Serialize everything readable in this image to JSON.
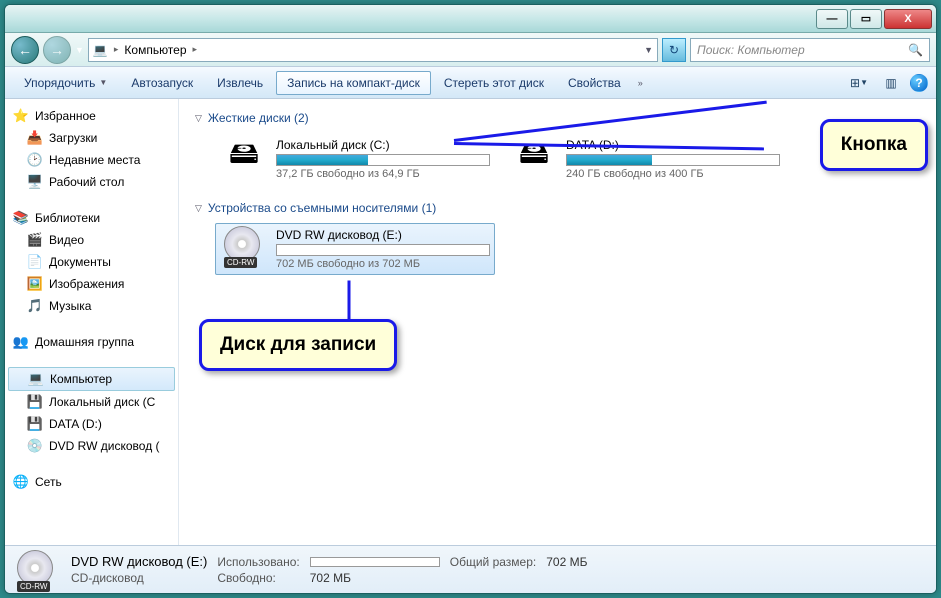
{
  "window": {
    "min": "—",
    "max": "▭",
    "close": "X"
  },
  "nav": {
    "crumb_root_icon": "💻",
    "crumb1": "Компьютер",
    "search_placeholder": "Поиск: Компьютер"
  },
  "toolbar": {
    "organize": "Упорядочить",
    "autoplay": "Автозапуск",
    "eject": "Извлечь",
    "burn": "Запись на компакт-диск",
    "erase": "Стереть этот диск",
    "properties": "Свойства"
  },
  "sidebar": {
    "favorites": "Избранное",
    "downloads": "Загрузки",
    "recent": "Недавние места",
    "desktop": "Рабочий стол",
    "libraries": "Библиотеки",
    "videos": "Видео",
    "documents": "Документы",
    "pictures": "Изображения",
    "music": "Музыка",
    "homegroup": "Домашняя группа",
    "computer": "Компьютер",
    "localdisk": "Локальный диск (C",
    "datad": "DATA (D:)",
    "dvdrw": "DVD RW дисковод (",
    "network": "Сеть"
  },
  "sections": {
    "hdd": "Жесткие диски (2)",
    "removable": "Устройства со съемными носителями (1)"
  },
  "drives": {
    "c": {
      "name": "Локальный диск (C:)",
      "free": "37,2 ГБ свободно из 64,9 ГБ",
      "fill": 43
    },
    "d": {
      "name": "DATA (D:)",
      "free": "240 ГБ свободно из 400 ГБ",
      "fill": 40
    },
    "e": {
      "name": "DVD RW дисковод (E:)",
      "free": "702 МБ свободно из 702 МБ",
      "fill": 0
    }
  },
  "callouts": {
    "button": "Кнопка",
    "disc": "Диск для записи"
  },
  "status": {
    "title": "DVD RW дисковод (E:)",
    "type": "CD-дисковод",
    "used_label": "Использовано:",
    "free_label": "Свободно:",
    "free_val": "702 МБ",
    "total_label": "Общий размер:",
    "total_val": "702 МБ"
  },
  "cd_badge": "CD-RW"
}
